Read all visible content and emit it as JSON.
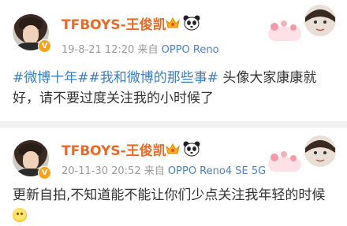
{
  "posts": [
    {
      "author": "TFBOYS-王俊凯",
      "verified_badge": "V",
      "time": "19-8-21 12:20",
      "source_prefix": "来自",
      "source_app": "OPPO Reno",
      "hashtags": [
        "#微博十年#",
        "#我和微博的那些事#"
      ],
      "text": " 头像大家康康就好，请不要过度关注我的小时候了"
    },
    {
      "author": "TFBOYS-王俊凯",
      "verified_badge": "V",
      "time": "20-11-30 20:52",
      "source_prefix": "来自",
      "source_app": "OPPO Reno4 SE 5G",
      "text": "更新自拍,不知道能不能让你们少点关注我年轻的时候",
      "emoji": "smile-emoji"
    }
  ],
  "colors": {
    "author": "#e86a26",
    "hashtag": "#3a7dbe",
    "meta": "#9a9a9a",
    "source_app": "#4d7fbf",
    "badge": "#f7a21b",
    "separator": "#f2f2f2"
  }
}
